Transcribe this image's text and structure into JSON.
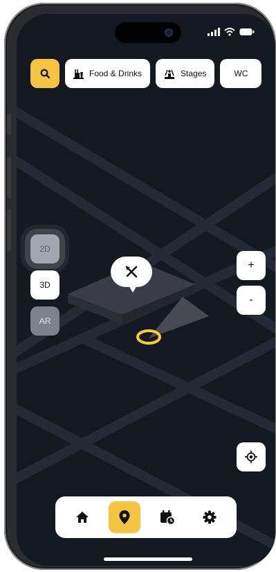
{
  "top_bar": {
    "search_icon": "search-icon",
    "chips": [
      {
        "label": "Food & Drinks",
        "icon": "food-drinks-icon"
      },
      {
        "label": "Stages",
        "icon": "stage-icon"
      },
      {
        "label": "WC"
      }
    ]
  },
  "view_modes": [
    {
      "label": "2D",
      "state": "selected"
    },
    {
      "label": "3D"
    },
    {
      "label": "AR"
    }
  ],
  "zoom": {
    "plus": "+",
    "minus": "-"
  },
  "map": {
    "marker_icon": "cutlery-icon"
  },
  "bottom_nav": [
    {
      "icon": "home-icon",
      "active": false
    },
    {
      "icon": "map-pin-icon",
      "active": true
    },
    {
      "icon": "calendar-clock-icon",
      "active": false
    },
    {
      "icon": "settings-icon",
      "active": false
    }
  ],
  "colors": {
    "accent": "#f5c542",
    "map_background": "#141821",
    "road": "#242936",
    "location_ring": "#f5d028"
  }
}
